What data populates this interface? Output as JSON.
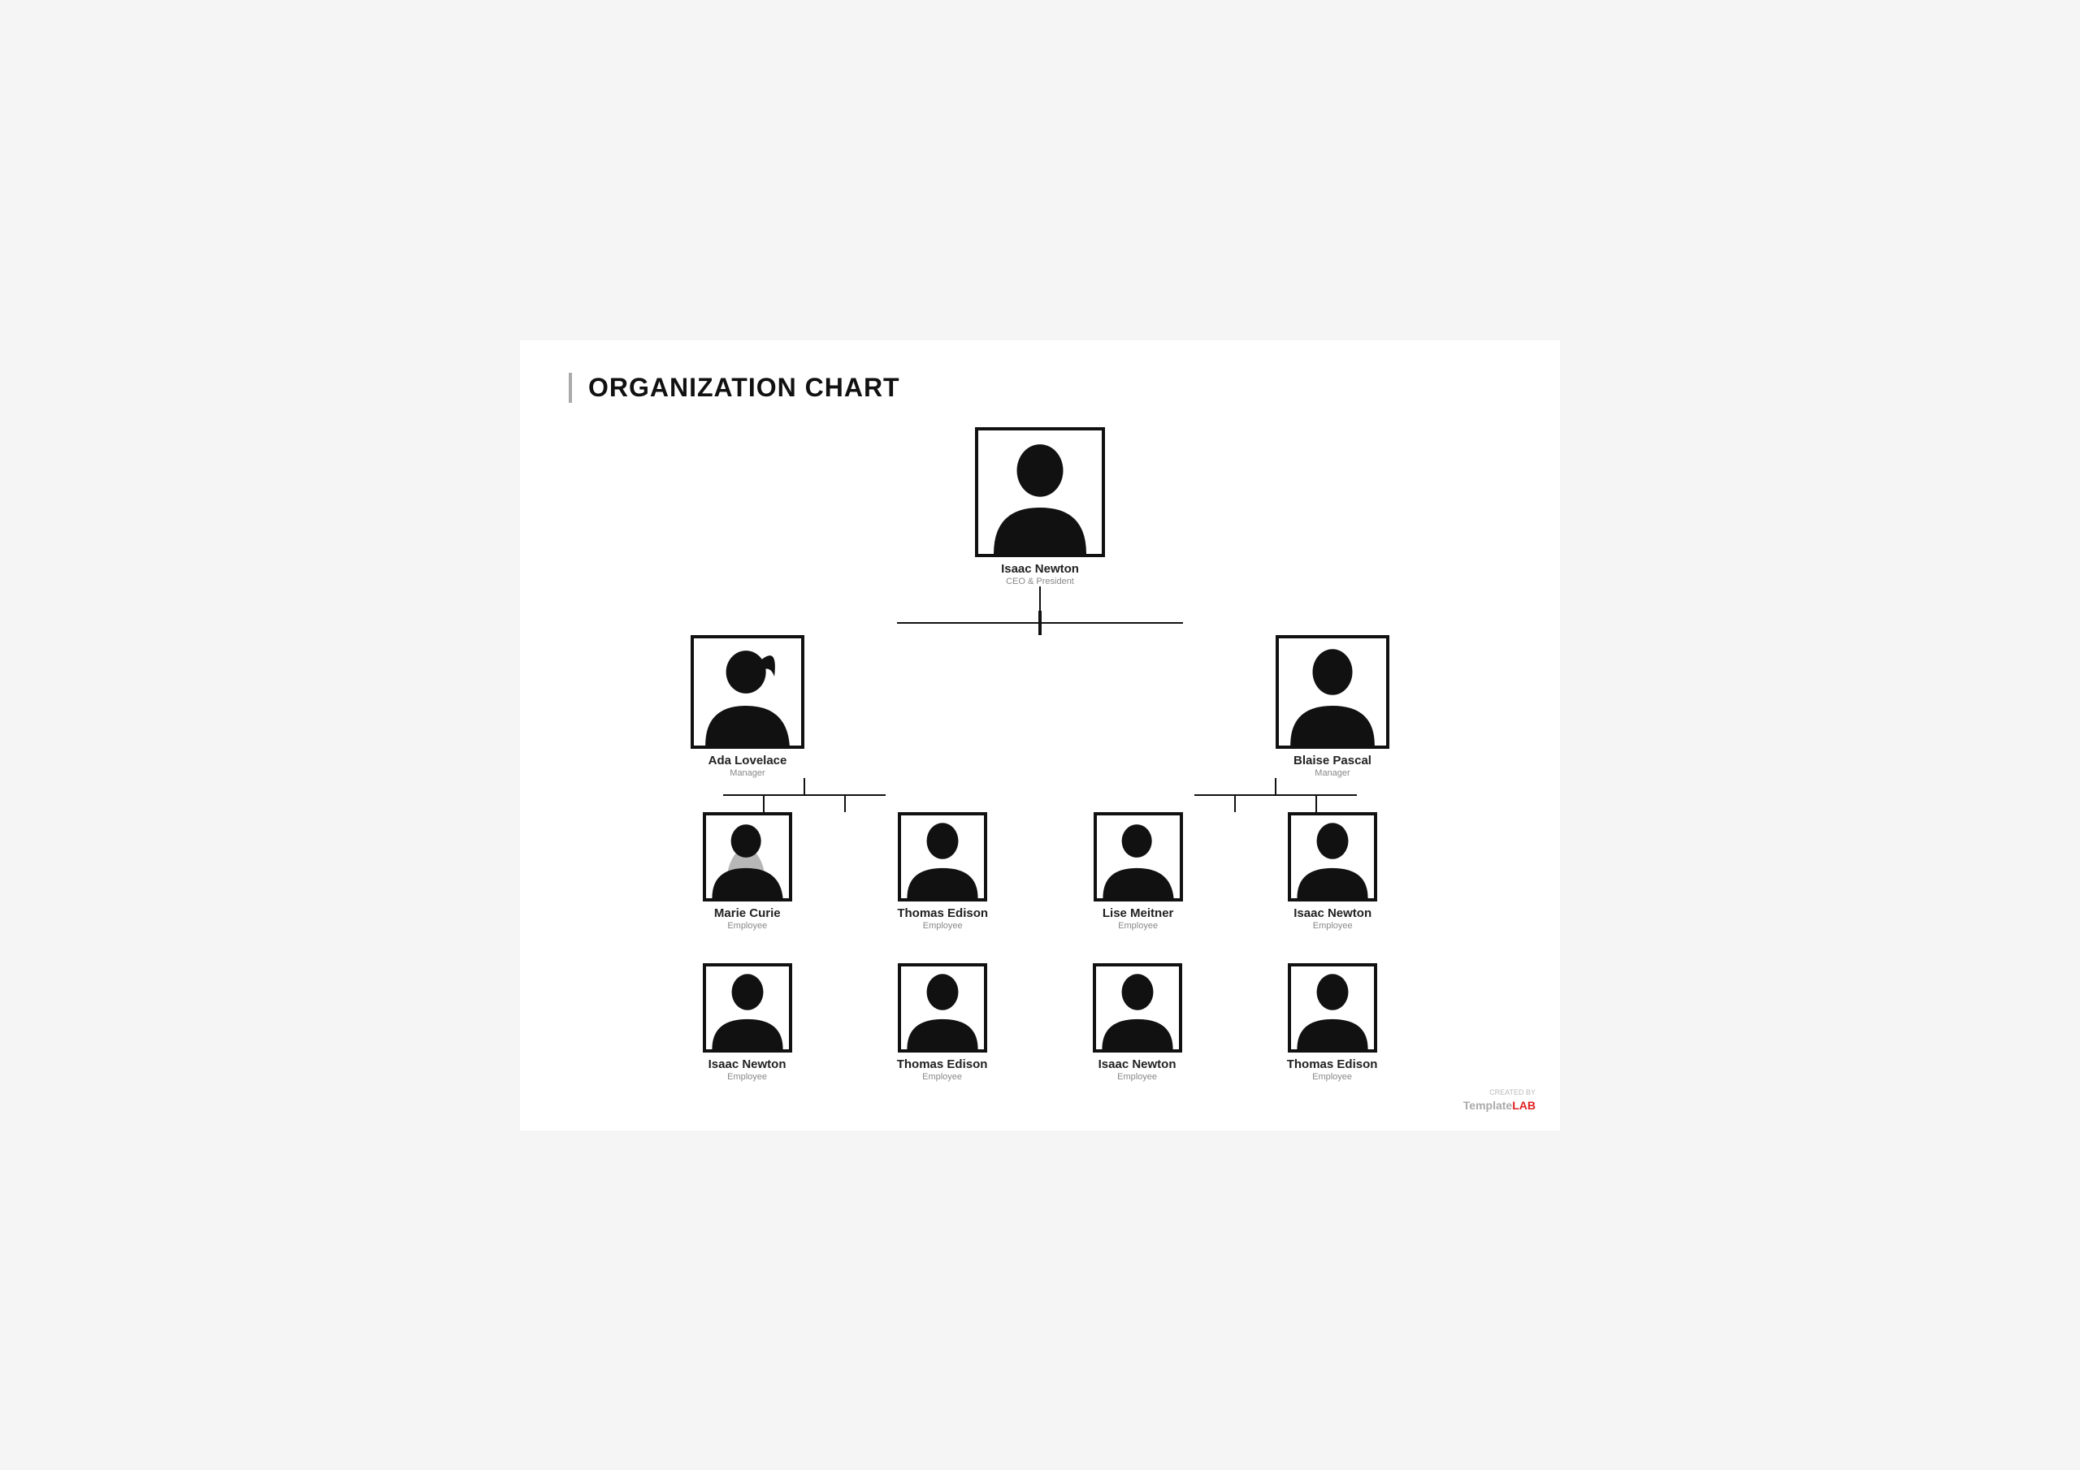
{
  "title": "ORGANIZATION CHART",
  "brand": {
    "created_by": "CREATED BY",
    "name": "Template",
    "lab": "LAB"
  },
  "ceo": {
    "name": "Isaac Newton",
    "title": "CEO & President",
    "gender": "male"
  },
  "managers": [
    {
      "name": "Ada Lovelace",
      "title": "Manager",
      "gender": "female"
    },
    {
      "name": "Blaise Pascal",
      "title": "Manager",
      "gender": "male"
    }
  ],
  "employees_row1": [
    {
      "name": "Marie Curie",
      "title": "Employee",
      "gender": "female",
      "manager": 0
    },
    {
      "name": "Thomas Edison",
      "title": "Employee",
      "gender": "male",
      "manager": 0
    },
    {
      "name": "Lise Meitner",
      "title": "Employee",
      "gender": "female",
      "manager": 1
    },
    {
      "name": "Isaac Newton",
      "title": "Employee",
      "gender": "male",
      "manager": 1
    }
  ],
  "employees_row2": [
    {
      "name": "Isaac Newton",
      "title": "Employee",
      "gender": "male"
    },
    {
      "name": "Thomas Edison",
      "title": "Employee",
      "gender": "male"
    },
    {
      "name": "Isaac Newton",
      "title": "Employee",
      "gender": "male"
    },
    {
      "name": "Thomas Edison",
      "title": "Employee",
      "gender": "male"
    }
  ]
}
